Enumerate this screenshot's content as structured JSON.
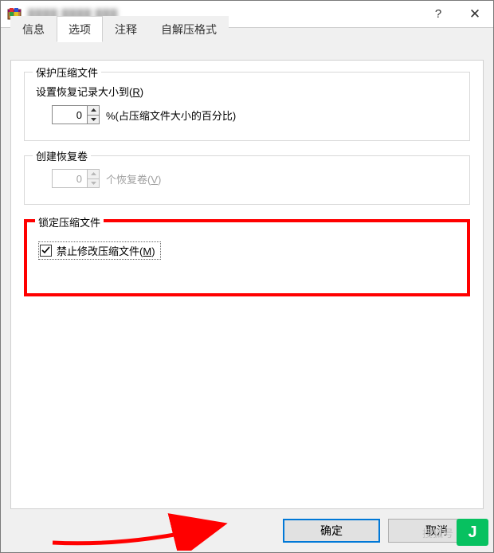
{
  "titlebar": {
    "title_obscured": "████ ████ ███",
    "help_symbol": "?",
    "close_symbol": "✕"
  },
  "tabs": [
    {
      "label": "信息",
      "active": false
    },
    {
      "label": "选项",
      "active": true
    },
    {
      "label": "注释",
      "active": false
    },
    {
      "label": "自解压格式",
      "active": false
    }
  ],
  "groups": {
    "protect": {
      "title": "保护压缩文件",
      "recovery_label_prefix": "设置恢复记录大小到(",
      "recovery_label_hotkey": "R",
      "recovery_label_suffix": ")",
      "recovery_value": "0",
      "percent_label": "%(占压缩文件大小的百分比)"
    },
    "volumes": {
      "title": "创建恢复卷",
      "volumes_value": "0",
      "volumes_label_prefix": "个恢复卷(",
      "volumes_label_hotkey": "V",
      "volumes_label_suffix": ")"
    },
    "lock": {
      "title": "锁定压缩文件",
      "checkbox_checked": true,
      "checkbox_label_prefix": "禁止修改压缩文件(",
      "checkbox_label_hotkey": "M",
      "checkbox_label_suffix": ")"
    }
  },
  "buttons": {
    "ok": "确定",
    "cancel": "取消"
  },
  "watermark": {
    "text": "搜狐号",
    "badge": "J"
  }
}
